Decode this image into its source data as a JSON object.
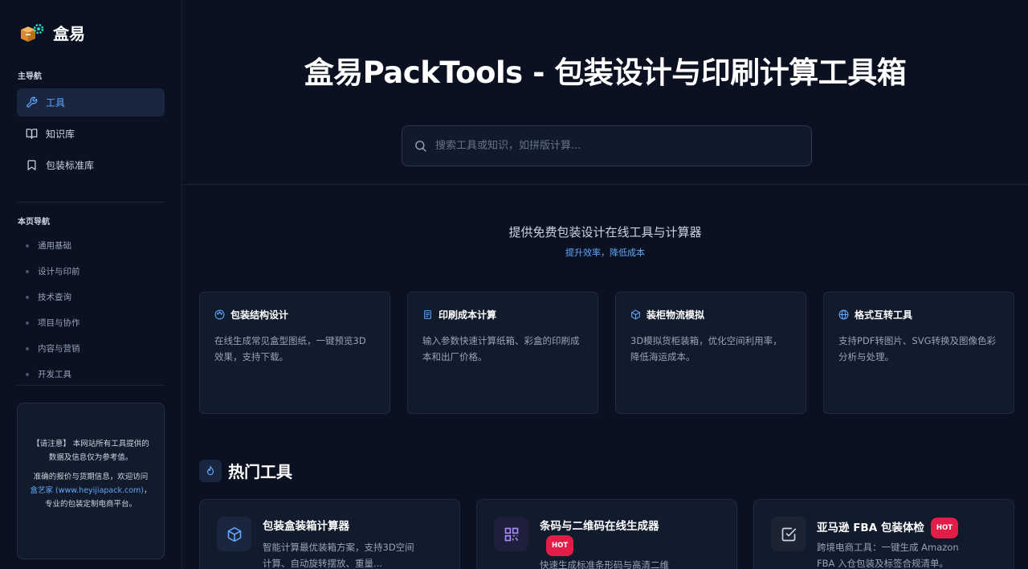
{
  "sidebar": {
    "brand": "盒易",
    "main_nav_heading": "主导航",
    "main_nav": [
      {
        "label": "工具",
        "icon": "wrench-icon",
        "active": true
      },
      {
        "label": "知识库",
        "icon": "book-open-icon",
        "active": false
      },
      {
        "label": "包装标准库",
        "icon": "bookmark-icon",
        "active": false
      }
    ],
    "page_nav_heading": "本页导航",
    "page_nav": [
      "通用基础",
      "设计与印前",
      "技术查询",
      "项目与协作",
      "内容与营销",
      "开发工具"
    ],
    "notice": {
      "line1": "【请注意】 本网站所有工具提供的数据及信息仅为参考值。",
      "line2_prefix": "准确的报价与货期信息，欢迎访问 ",
      "line2_link": "盒艺家 (www.heyijiapack.com)",
      "line2_suffix": "，专业的包装定制电商平台。"
    }
  },
  "header": {
    "title": "盒易PackTools - 包装设计与印刷计算工具箱"
  },
  "search": {
    "placeholder": "搜索工具或知识，如拼版计算..."
  },
  "hero": {
    "subtitle": "提供免费包装设计在线工具与计算器",
    "tagline": "提升效率，降低成本"
  },
  "features": [
    {
      "title": "包装结构设计",
      "icon": "palette-icon",
      "desc": "在线生成常见盒型图纸，一键预览3D效果，支持下载。"
    },
    {
      "title": "印刷成本计算",
      "icon": "receipt-icon",
      "desc": "输入参数快速计算纸箱、彩盒的印刷成本和出厂价格。"
    },
    {
      "title": "装柜物流模拟",
      "icon": "cube-icon",
      "desc": "3D模拟货柜装箱，优化空间利用率，降低海运成本。"
    },
    {
      "title": "格式互转工具",
      "icon": "globe-icon",
      "desc": "支持PDF转图片、SVG转换及图像色彩分析与处理。"
    }
  ],
  "hot_tools": {
    "heading": "热门工具",
    "items": [
      {
        "title": "包装盒装箱计算器",
        "hot": false,
        "badge": "",
        "icon": "box-icon",
        "desc": "智能计算最优装箱方案，支持3D空间计算、自动旋转摆放、重量..."
      },
      {
        "title": "条码与二维码在线生成器",
        "hot": true,
        "badge": "HOT",
        "icon": "qrcode-icon",
        "desc": "快速生成标准条形码与高清二维"
      },
      {
        "title": "亚马逊 FBA 包装体检",
        "hot": true,
        "badge": "HOT",
        "icon": "checkbox-icon",
        "desc": "跨境电商工具：一键生成 Amazon FBA 入仓包装及标签合规清单。"
      }
    ]
  },
  "colors": {
    "background": "#0b1120",
    "card": "#121b2b",
    "accent": "#60a5fa",
    "hot_badge": "#e11d48"
  }
}
